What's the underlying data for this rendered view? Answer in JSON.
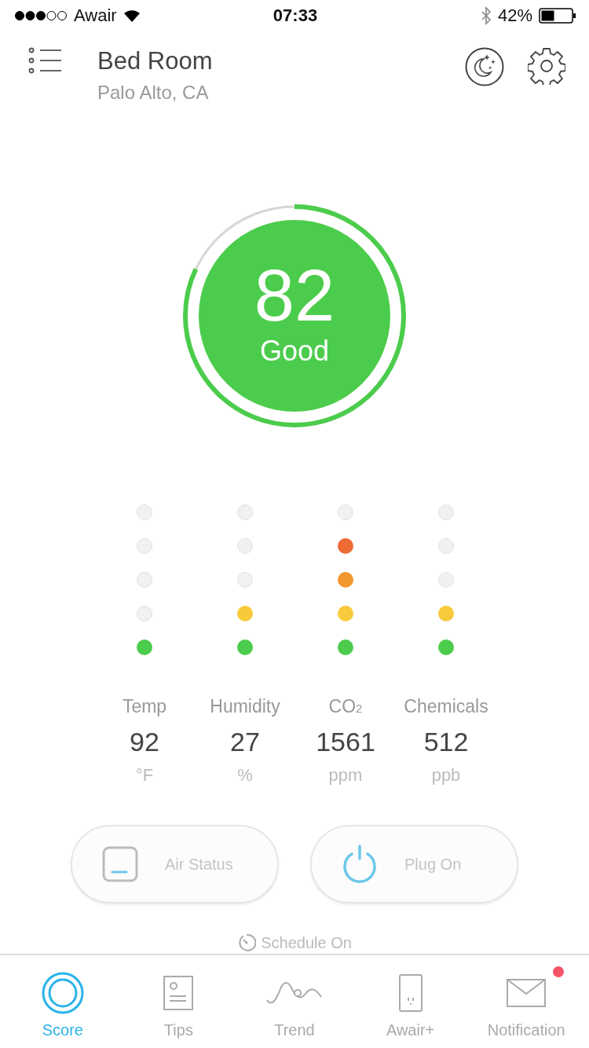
{
  "status_bar": {
    "carrier": "Awair",
    "time": "07:33",
    "battery": "42%"
  },
  "header": {
    "title": "Bed Room",
    "subtitle": "Palo Alto, CA"
  },
  "score": {
    "value": "82",
    "label": "Good",
    "level": 0.82
  },
  "sensors": [
    {
      "name": "Temp",
      "value": "92",
      "unit": "°F",
      "dots": [
        {
          "on": false
        },
        {
          "on": false
        },
        {
          "on": false
        },
        {
          "on": false
        },
        {
          "on": true,
          "color": "#4ccc4c"
        }
      ]
    },
    {
      "name": "Humidity",
      "value": "27",
      "unit": "%",
      "dots": [
        {
          "on": false
        },
        {
          "on": false
        },
        {
          "on": false
        },
        {
          "on": true,
          "color": "#f8c93a"
        },
        {
          "on": true,
          "color": "#4ccc4c"
        }
      ]
    },
    {
      "name": "CO$_{2}$",
      "value": "1561",
      "unit": "ppm",
      "dots": [
        {
          "on": false
        },
        {
          "on": true,
          "color": "#ee6a35"
        },
        {
          "on": true,
          "color": "#f2972f"
        },
        {
          "on": true,
          "color": "#f8c93a"
        },
        {
          "on": true,
          "color": "#4ccc4c"
        }
      ]
    },
    {
      "name": "Chemicals",
      "value": "512",
      "unit": "ppb",
      "dots": [
        {
          "on": false
        },
        {
          "on": false
        },
        {
          "on": false
        },
        {
          "on": true,
          "color": "#f8c93a"
        },
        {
          "on": true,
          "color": "#4ccc4c"
        }
      ]
    }
  ],
  "actions": [
    {
      "kind": "display",
      "label": "Air Status"
    },
    {
      "kind": "power",
      "label": "Plug On"
    }
  ],
  "schedule": "Schedule On",
  "tabs": [
    {
      "kind": "score",
      "label": "Score",
      "selected": true,
      "badge": false
    },
    {
      "kind": "tips",
      "label": "Tips",
      "selected": false,
      "badge": false
    },
    {
      "kind": "trend",
      "label": "Trend",
      "selected": false,
      "badge": false
    },
    {
      "kind": "device",
      "label": "Awair+",
      "selected": false,
      "badge": false
    },
    {
      "kind": "mail",
      "label": "Notification",
      "selected": false,
      "badge": true
    }
  ]
}
